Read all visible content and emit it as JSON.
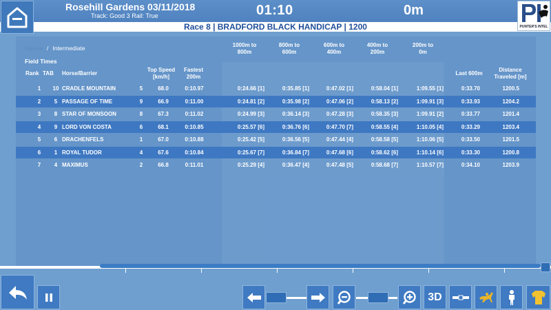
{
  "header": {
    "venue": "Rosehill Gardens 03/11/2018",
    "track": "Track: Good 3 Rail: True",
    "clock": "01:10",
    "distance": "0m",
    "logo_text": "PUNTER'S INTEL",
    "race_title": "Race 8 | BRADFORD BLACK HANDICAP | 1200"
  },
  "view_tabs": {
    "inactive": "Novice",
    "separator": "/",
    "active": "Intermediate"
  },
  "section_label": "Field Times",
  "columns": {
    "rank": "Rank",
    "tab": "TAB",
    "horse": "Horse/Barrier",
    "top_speed": [
      "Top Speed",
      "[km/h]"
    ],
    "fastest": [
      "Fastest",
      "200m"
    ],
    "s1": [
      "1000m to",
      "800m"
    ],
    "s2": [
      "800m to",
      "600m"
    ],
    "s3": [
      "600m to",
      "400m"
    ],
    "s4": [
      "400m to",
      "200m"
    ],
    "s5": [
      "200m to",
      "0m"
    ],
    "last600": "Last 600m",
    "distance": [
      "Distance",
      "Traveled [m]"
    ]
  },
  "rows": [
    {
      "rank": "1",
      "tab": "10",
      "horse": "CRADLE MOUNTAIN",
      "barrier": "5",
      "top_speed": "68.0",
      "fastest": "0:10.97",
      "s1": "0:24.66 [1]",
      "s2": "0:35.85 [1]",
      "s3": "0:47.02 [1]",
      "s4": "0:58.04 [1]",
      "s5": "1:09.55 [1]",
      "last600": "0:33.70",
      "distance": "1200.5",
      "highlight": false
    },
    {
      "rank": "2",
      "tab": "5",
      "horse": "PASSAGE OF TIME",
      "barrier": "9",
      "top_speed": "66.9",
      "fastest": "0:11.00",
      "s1": "0:24.81 [2]",
      "s2": "0:35.98 [2]",
      "s3": "0:47.06 [2]",
      "s4": "0:58.13 [2]",
      "s5": "1:09.91 [3]",
      "last600": "0:33.93",
      "distance": "1204.2",
      "highlight": true
    },
    {
      "rank": "3",
      "tab": "8",
      "horse": "STAR OF MONSOON",
      "barrier": "8",
      "top_speed": "67.3",
      "fastest": "0:11.02",
      "s1": "0:24.99 [3]",
      "s2": "0:36.14 [3]",
      "s3": "0:47.28 [3]",
      "s4": "0:58.35 [3]",
      "s5": "1:09.91 [2]",
      "last600": "0:33.77",
      "distance": "1201.4",
      "highlight": false
    },
    {
      "rank": "4",
      "tab": "9",
      "horse": "LORD VON COSTA",
      "barrier": "6",
      "top_speed": "68.1",
      "fastest": "0:10.85",
      "s1": "0:25.57 [6]",
      "s2": "0:36.76 [6]",
      "s3": "0:47.70 [7]",
      "s4": "0:58.55 [4]",
      "s5": "1:10.05 [4]",
      "last600": "0:33.29",
      "distance": "1203.4",
      "highlight": true
    },
    {
      "rank": "5",
      "tab": "6",
      "horse": "DRACHENFELS",
      "barrier": "1",
      "top_speed": "67.0",
      "fastest": "0:10.88",
      "s1": "0:25.42 [5]",
      "s2": "0:36.56 [5]",
      "s3": "0:47.44 [4]",
      "s4": "0:58.58 [5]",
      "s5": "1:10.06 [5]",
      "last600": "0:33.50",
      "distance": "1201.5",
      "highlight": false
    },
    {
      "rank": "6",
      "tab": "1",
      "horse": "ROYAL TUDOR",
      "barrier": "4",
      "top_speed": "67.6",
      "fastest": "0:10.84",
      "s1": "0:25.67 [7]",
      "s2": "0:36.84 [7]",
      "s3": "0:47.68 [6]",
      "s4": "0:58.62 [6]",
      "s5": "1:10.14 [6]",
      "last600": "0:33.30",
      "distance": "1200.8",
      "highlight": true
    },
    {
      "rank": "7",
      "tab": "4",
      "horse": "MAXIMUS",
      "barrier": "2",
      "top_speed": "66.8",
      "fastest": "0:11.01",
      "s1": "0:25.29 [4]",
      "s2": "0:36.47 [4]",
      "s3": "0:47.48 [5]",
      "s4": "0:58.68 [7]",
      "s5": "1:10.57 [7]",
      "last600": "0:34.10",
      "distance": "1203.9",
      "highlight": false
    }
  ],
  "controls": {
    "three_d_label": "3D",
    "playback_position": 1.0
  },
  "colors": {
    "background": "#6f9fcf",
    "highlight_row": "#3e78c2",
    "button": "#3f7ac2",
    "race_title": "#1f4f9a",
    "jersey_icon": "#f2c230"
  }
}
